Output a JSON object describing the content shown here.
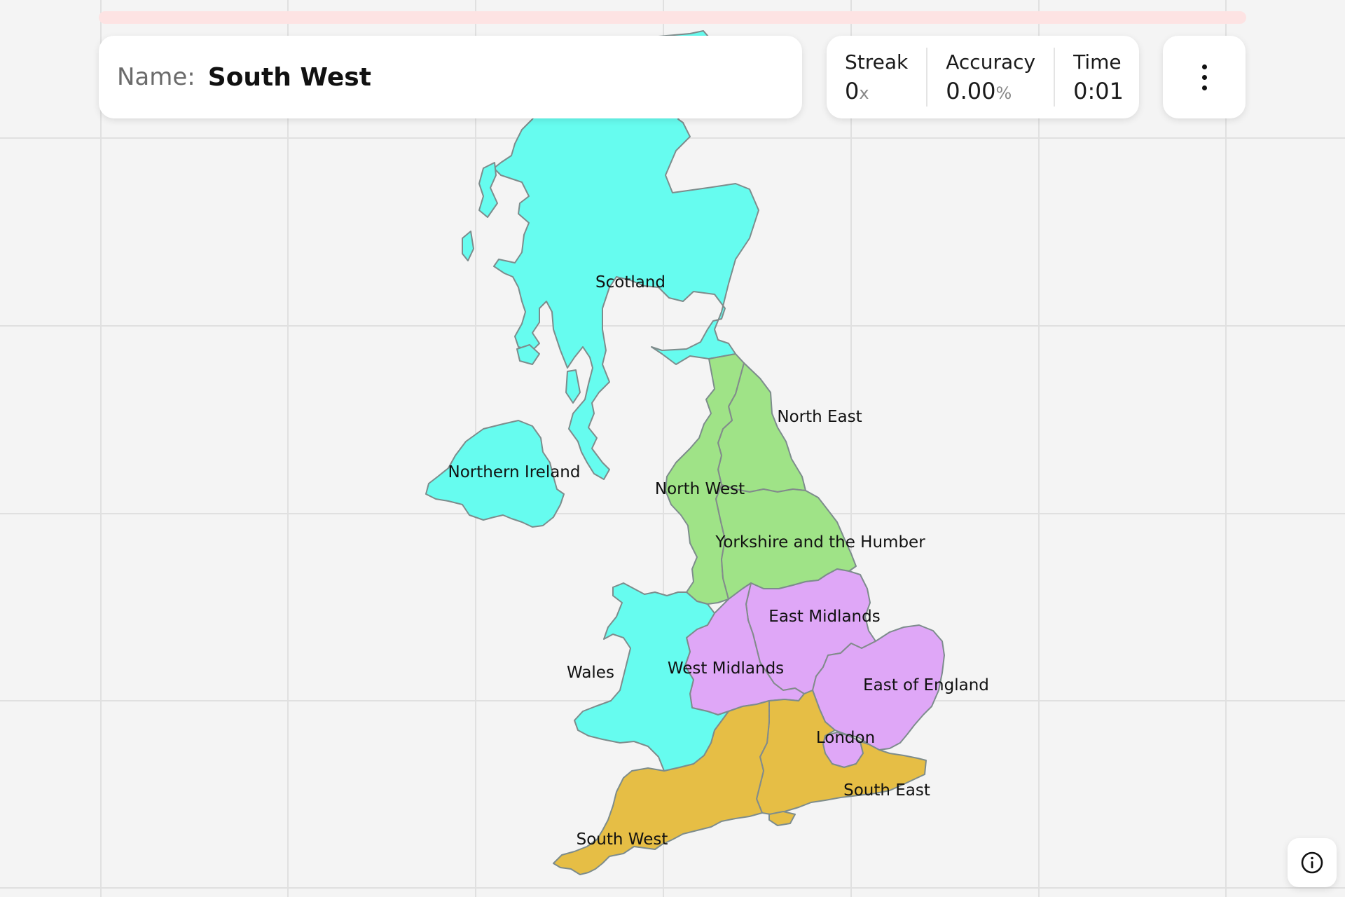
{
  "header": {
    "progress_fraction": 0.0
  },
  "prompt": {
    "label": "Name:",
    "value": "South West"
  },
  "stats": {
    "streak": {
      "label": "Streak",
      "value": "0",
      "unit": "x"
    },
    "accuracy": {
      "label": "Accuracy",
      "value": "0.00",
      "unit": "%"
    },
    "time": {
      "label": "Time",
      "value": "0:01"
    }
  },
  "menu": {
    "icon": "kebab-menu-icon"
  },
  "info": {
    "icon": "info-icon"
  },
  "map": {
    "colors": {
      "cyan": "#66fcef",
      "green": "#9fe387",
      "purple": "#dfa7f7",
      "gold": "#e6be45",
      "background": "#f4f4f4"
    },
    "regions": [
      {
        "id": "scotland",
        "label": "Scotland",
        "color": "#66fcef"
      },
      {
        "id": "northern-ireland",
        "label": "Northern Ireland",
        "color": "#66fcef"
      },
      {
        "id": "wales",
        "label": "Wales",
        "color": "#66fcef"
      },
      {
        "id": "north-east",
        "label": "North East",
        "color": "#9fe387"
      },
      {
        "id": "north-west",
        "label": "North West",
        "color": "#9fe387"
      },
      {
        "id": "yorkshire",
        "label": "Yorkshire and the Humber",
        "color": "#9fe387"
      },
      {
        "id": "east-midlands",
        "label": "East Midlands",
        "color": "#dfa7f7"
      },
      {
        "id": "west-midlands",
        "label": "West Midlands",
        "color": "#dfa7f7"
      },
      {
        "id": "east-of-england",
        "label": "East of England",
        "color": "#dfa7f7"
      },
      {
        "id": "london",
        "label": "London",
        "color": "#dfa7f7"
      },
      {
        "id": "south-east",
        "label": "South East",
        "color": "#e6be45"
      },
      {
        "id": "south-west",
        "label": "South West",
        "color": "#e6be45"
      }
    ]
  }
}
